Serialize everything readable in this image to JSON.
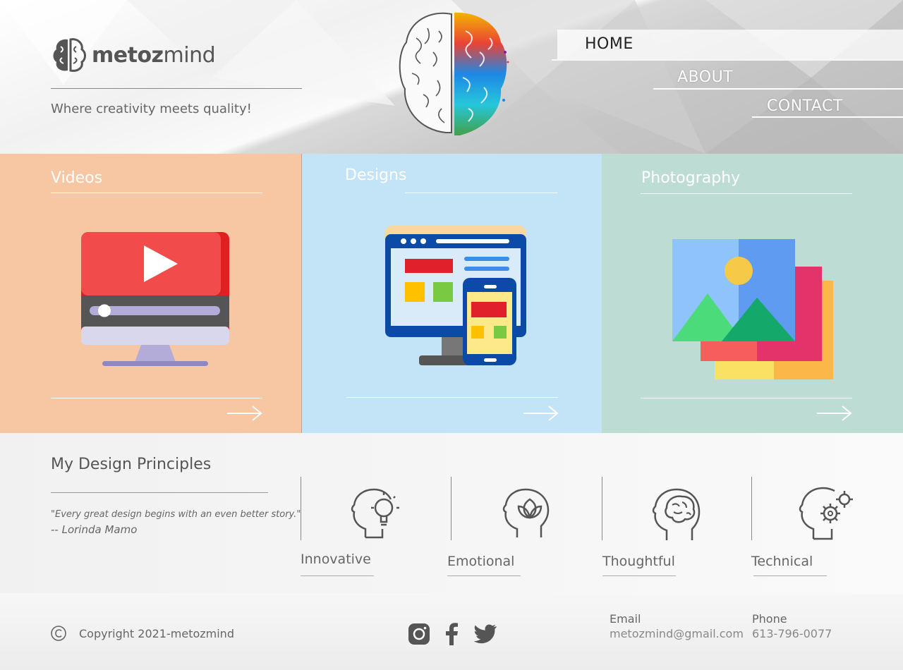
{
  "brand": {
    "name_bold": "metoz",
    "name_light": "mind",
    "tagline": "Where creativity meets quality!"
  },
  "nav": {
    "items": [
      {
        "label": "HOME"
      },
      {
        "label": "ABOUT"
      },
      {
        "label": "CONTACT"
      }
    ]
  },
  "cards": [
    {
      "title": "Videos",
      "bg": "#f7c6a3"
    },
    {
      "title": "Designs",
      "bg": "#c2e4f6"
    },
    {
      "title": "Photography",
      "bg": "#bcdcd4"
    }
  ],
  "principles": {
    "title": "My Design Principles",
    "quote": "\"Every great design begins with an even better story.\"",
    "author": "-- Lorinda Mamo",
    "items": [
      {
        "label": "Innovative",
        "icon": "head-lightbulb-icon"
      },
      {
        "label": "Emotional",
        "icon": "head-lotus-icon"
      },
      {
        "label": "Thoughtful",
        "icon": "head-brain-icon"
      },
      {
        "label": "Technical",
        "icon": "head-gear-icon"
      }
    ]
  },
  "footer": {
    "copyright": "Copyright 2021-metozmind",
    "email_label": "Email",
    "email": "metozmind@gmail.com",
    "phone_label": "Phone",
    "phone": "613-796-0077",
    "social": [
      "instagram-icon",
      "facebook-icon",
      "twitter-icon"
    ]
  }
}
